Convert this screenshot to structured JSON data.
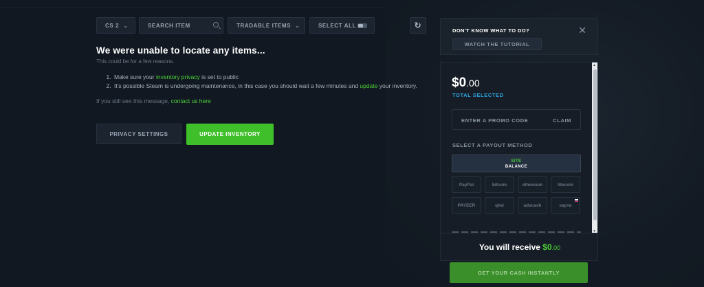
{
  "filters": {
    "game_label": "CS 2",
    "search_placeholder": "SEARCH ITEM",
    "tradable_label": "TRADABLE ITEMS",
    "select_all_label": "SELECT ALL"
  },
  "message": {
    "title": "We were unable to locate any items...",
    "subtitle": "This could be for a few reasons.",
    "item1_pre": "Make sure your ",
    "item1_link": "inventory privacy",
    "item1_post": " is set to public",
    "item2_pre": "It's possible Steam is undergoing maintenance, in this case you should wait a few minutes and ",
    "item2_link": "update",
    "item2_post": " your inventory.",
    "contact_pre": "If you still see this message, ",
    "contact_link": "contact us here"
  },
  "actions": {
    "privacy_settings": "PRIVACY SETTINGS",
    "update_inventory": "UPDATE INVENTORY"
  },
  "help": {
    "question": "DON'T KNOW WHAT TO DO?",
    "tutorial": "WATCH THE TUTORIAL"
  },
  "cart": {
    "amount_main": "$0",
    "amount_cents": ".00",
    "total_label": "TOTAL SELECTED",
    "promo_placeholder": "ENTER A PROMO CODE",
    "claim_label": "CLAIM",
    "payout_label": "SELECT A PAYOUT METHOD",
    "site_balance_line1": "SITE",
    "site_balance_line2": "BALANCE",
    "payment_methods": [
      "PayPal",
      "bitcoin",
      "ethereum",
      "litecoin",
      "PAYEER",
      "qiwi",
      "advcash",
      "карта"
    ]
  },
  "receive": {
    "label": "You will receive ",
    "amount_main": "$0",
    "amount_cents": ".00"
  },
  "cash_button": "GET YOUR CASH INSTANTLY"
}
